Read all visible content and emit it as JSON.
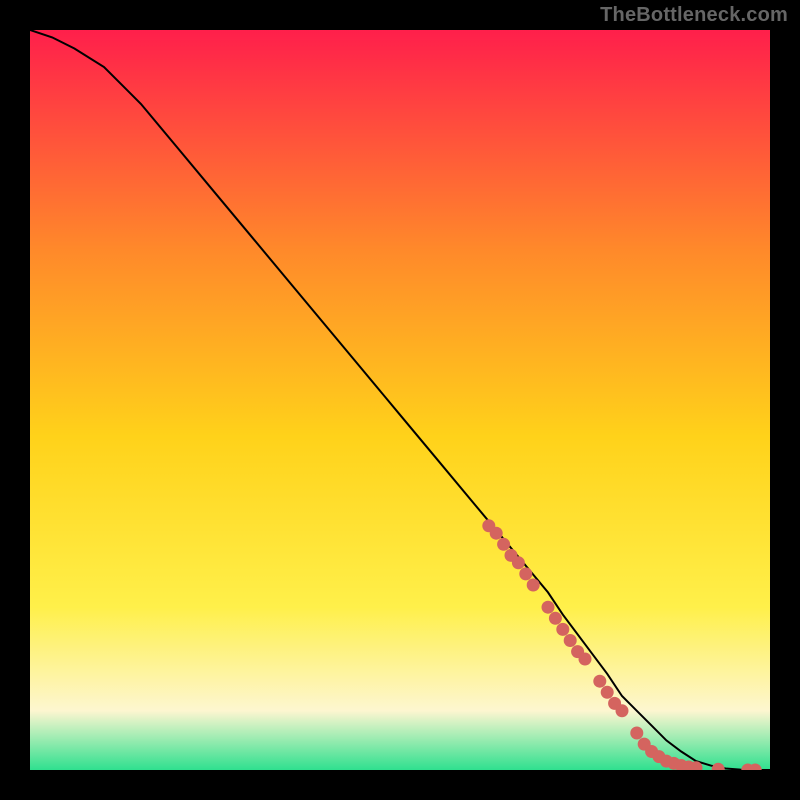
{
  "watermark": "TheBottleneck.com",
  "colors": {
    "gradient_top": "#ff1f4b",
    "gradient_mid1": "#ff8a2a",
    "gradient_mid2": "#ffd21a",
    "gradient_mid3": "#fff04a",
    "gradient_low": "#fdf6d0",
    "gradient_bottom": "#2fe08f",
    "curve": "#000000",
    "marker": "#d4645f"
  },
  "chart_data": {
    "type": "line",
    "title": "",
    "xlabel": "",
    "ylabel": "",
    "xlim": [
      0,
      100
    ],
    "ylim": [
      0,
      100
    ],
    "series": [
      {
        "name": "curve",
        "x": [
          0,
          3,
          6,
          10,
          15,
          20,
          25,
          30,
          35,
          40,
          45,
          50,
          55,
          60,
          65,
          70,
          72,
          75,
          78,
          80,
          82,
          84,
          86,
          88,
          90,
          92,
          94,
          96,
          98,
          100
        ],
        "y": [
          100,
          99,
          97.5,
          95,
          90,
          84,
          78,
          72,
          66,
          60,
          54,
          48,
          42,
          36,
          30,
          24,
          21,
          17,
          13,
          10,
          8,
          6,
          4,
          2.5,
          1.2,
          0.6,
          0.2,
          0.05,
          0,
          0
        ]
      }
    ],
    "markers": [
      {
        "x": 62,
        "y": 33
      },
      {
        "x": 63,
        "y": 32
      },
      {
        "x": 64,
        "y": 30.5
      },
      {
        "x": 65,
        "y": 29
      },
      {
        "x": 66,
        "y": 28
      },
      {
        "x": 67,
        "y": 26.5
      },
      {
        "x": 68,
        "y": 25
      },
      {
        "x": 70,
        "y": 22
      },
      {
        "x": 71,
        "y": 20.5
      },
      {
        "x": 72,
        "y": 19
      },
      {
        "x": 73,
        "y": 17.5
      },
      {
        "x": 74,
        "y": 16
      },
      {
        "x": 75,
        "y": 15
      },
      {
        "x": 77,
        "y": 12
      },
      {
        "x": 78,
        "y": 10.5
      },
      {
        "x": 79,
        "y": 9
      },
      {
        "x": 80,
        "y": 8
      },
      {
        "x": 82,
        "y": 5
      },
      {
        "x": 83,
        "y": 3.5
      },
      {
        "x": 84,
        "y": 2.5
      },
      {
        "x": 85,
        "y": 1.8
      },
      {
        "x": 86,
        "y": 1.2
      },
      {
        "x": 87,
        "y": 0.9
      },
      {
        "x": 88,
        "y": 0.6
      },
      {
        "x": 89,
        "y": 0.4
      },
      {
        "x": 90,
        "y": 0.3
      },
      {
        "x": 93,
        "y": 0.1
      },
      {
        "x": 97,
        "y": 0
      },
      {
        "x": 98,
        "y": 0
      }
    ]
  }
}
